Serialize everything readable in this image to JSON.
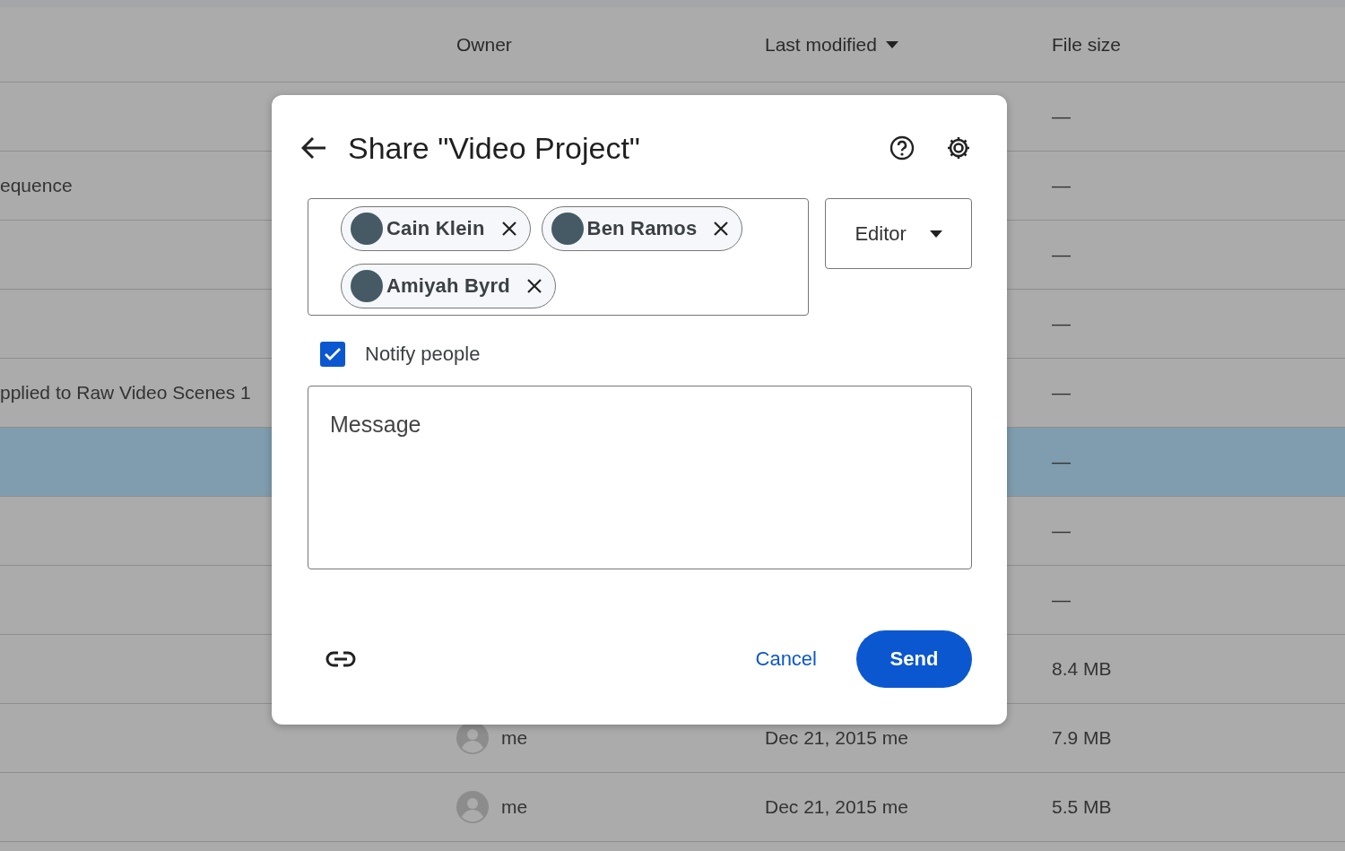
{
  "table": {
    "columns": [
      {
        "label": "Owner",
        "sorted": false
      },
      {
        "label": "Last modified",
        "sorted": true
      },
      {
        "label": "File size",
        "sorted": false
      }
    ],
    "rows": [
      {
        "size": "—",
        "selected": false
      },
      {
        "name": "equence",
        "size": "—",
        "selected": false
      },
      {
        "size": "—",
        "selected": false
      },
      {
        "size": "—",
        "selected": false
      },
      {
        "name": "pplied to Raw Video Scenes 1",
        "size": "—",
        "selected": false
      },
      {
        "size": "—",
        "selected": true
      },
      {
        "size": "—",
        "selected": false
      },
      {
        "size": "—",
        "selected": false
      },
      {
        "size": "8.4 MB",
        "selected": false
      },
      {
        "owner": "me",
        "modified": "Dec 21, 2015 me",
        "size": "7.9 MB",
        "selected": false
      },
      {
        "owner": "me",
        "modified": "Dec 21, 2015 me",
        "size": "5.5 MB",
        "selected": false
      }
    ]
  },
  "dialog": {
    "title": "Share \"Video Project\"",
    "chips": [
      {
        "name": "Cain Klein"
      },
      {
        "name": "Ben Ramos"
      },
      {
        "name": "Amiyah Byrd"
      }
    ],
    "role": "Editor",
    "notify": {
      "label": "Notify people",
      "checked": true
    },
    "message": {
      "placeholder": "Message"
    },
    "cancel": "Cancel",
    "send": "Send"
  }
}
